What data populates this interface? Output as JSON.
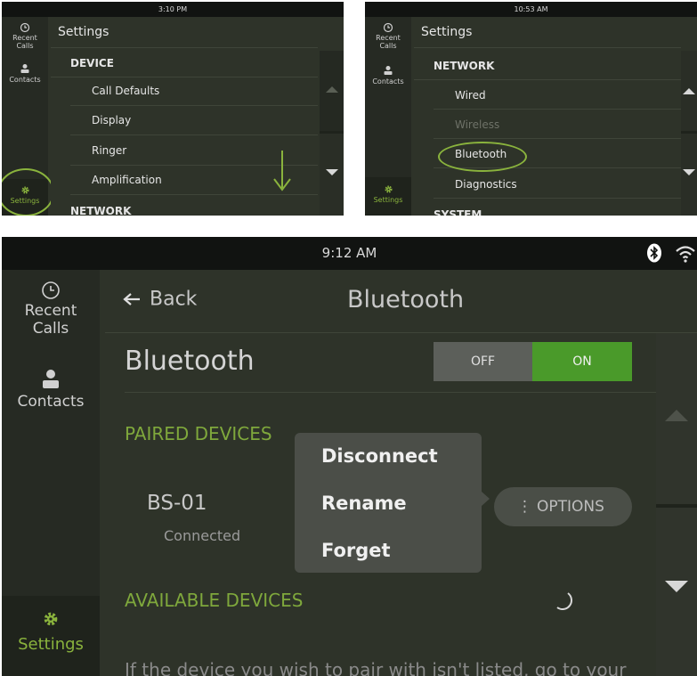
{
  "panel1": {
    "time": "3:10 PM",
    "nav": {
      "recent": "Recent Calls",
      "contacts": "Contacts",
      "settings": "Settings"
    },
    "title": "Settings",
    "section": "DEVICE",
    "items": [
      "Call Defaults",
      "Display",
      "Ringer",
      "Amplification"
    ],
    "next_section": "NETWORK"
  },
  "panel2": {
    "time": "10:53 AM",
    "nav": {
      "recent": "Recent Calls",
      "contacts": "Contacts",
      "settings": "Settings"
    },
    "title": "Settings",
    "section": "NETWORK",
    "items": [
      "Wired",
      "Wireless",
      "Bluetooth",
      "Diagnostics"
    ],
    "next_section": "SYSTEM"
  },
  "panel3": {
    "time": "9:12 AM",
    "nav": {
      "recent_line1": "Recent",
      "recent_line2": "Calls",
      "contacts": "Contacts",
      "settings": "Settings"
    },
    "back": "Back",
    "header_title": "Bluetooth",
    "section_title": "Bluetooth",
    "toggle": {
      "off": "OFF",
      "on": "ON",
      "state": "ON"
    },
    "paired_label": "PAIRED DEVICES",
    "device": {
      "name": "BS-01",
      "status": "Connected"
    },
    "options": "OPTIONS",
    "menu": [
      "Disconnect",
      "Rename",
      "Forget"
    ],
    "available_label": "AVAILABLE DEVICES",
    "footer_text": "If the device you wish to pair with isn't listed, go to your"
  },
  "colors": {
    "accent": "#8ab33d",
    "bg": "#2e3329",
    "nav": "#262a23",
    "statusbar": "#111311"
  }
}
